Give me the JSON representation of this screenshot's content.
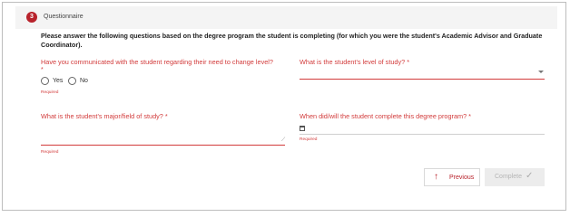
{
  "step": {
    "number": "3",
    "title": "Questionnaire"
  },
  "instructions": "Please answer the following questions based on the degree program the student is completing (for which you were the student's Academic Advisor and Graduate Coordinator).",
  "questions": {
    "communicated": {
      "label": "Have you communicated with the student regarding their need to change level?",
      "star": "*",
      "options": [
        "Yes",
        "No"
      ],
      "required_text": "Required"
    },
    "level": {
      "label": "What is the student's level of study? *",
      "value": ""
    },
    "major": {
      "label": "What is the student's major/field of study? *",
      "value": "",
      "required_text": "Required"
    },
    "completion": {
      "label": "When did/will the student complete this degree program? *",
      "value": "",
      "required_text": "Required"
    }
  },
  "buttons": {
    "previous": "Previous",
    "complete": "Complete"
  },
  "colors": {
    "accent": "#b8222b",
    "error": "#d23b3b"
  }
}
